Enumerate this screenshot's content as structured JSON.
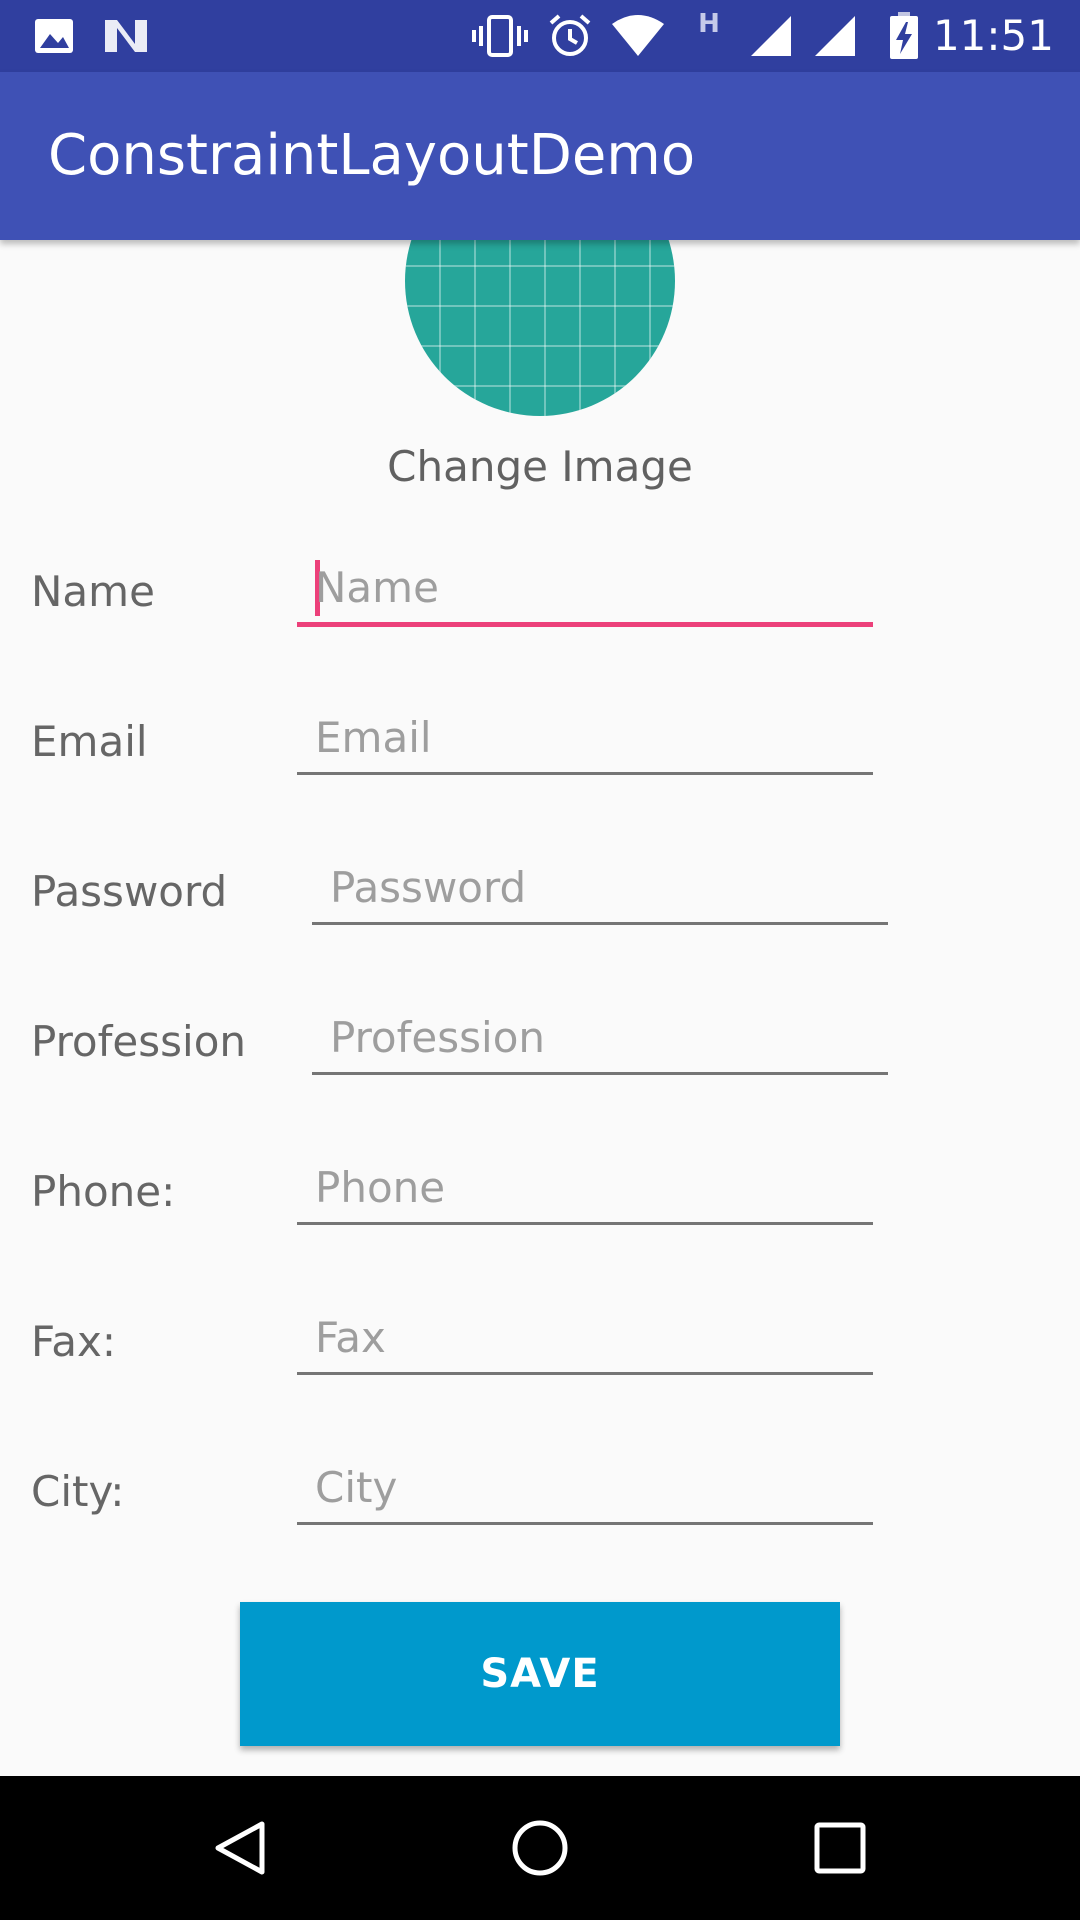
{
  "status_bar": {
    "time": "11:51",
    "network_type": "H",
    "icons": [
      "image-icon",
      "n-logo-icon",
      "vibrate-icon",
      "alarm-icon",
      "wifi-icon",
      "signal-icon",
      "signal-icon",
      "battery-charging-icon"
    ]
  },
  "app_bar": {
    "title": "ConstraintLayoutDemo"
  },
  "profile": {
    "change_image_label": "Change Image"
  },
  "form": {
    "name": {
      "label": "Name",
      "placeholder": "Name"
    },
    "email": {
      "label": "Email",
      "placeholder": "Email"
    },
    "password": {
      "label": "Password",
      "placeholder": "Password"
    },
    "profession": {
      "label": "Profession",
      "placeholder": "Profession"
    },
    "phone": {
      "label": "Phone:",
      "placeholder": "Phone"
    },
    "fax": {
      "label": "Fax:",
      "placeholder": "Fax"
    },
    "city": {
      "label": "City:",
      "placeholder": "City"
    }
  },
  "save_button": {
    "label": "SAVE"
  },
  "nav_bar": {
    "icons": [
      "back-icon",
      "home-icon",
      "recents-icon"
    ]
  },
  "colors": {
    "status_bar": "#303f9f",
    "app_bar": "#3f51b5",
    "accent": "#ec407a",
    "button": "#0099cc",
    "avatar": "#26a69a"
  }
}
